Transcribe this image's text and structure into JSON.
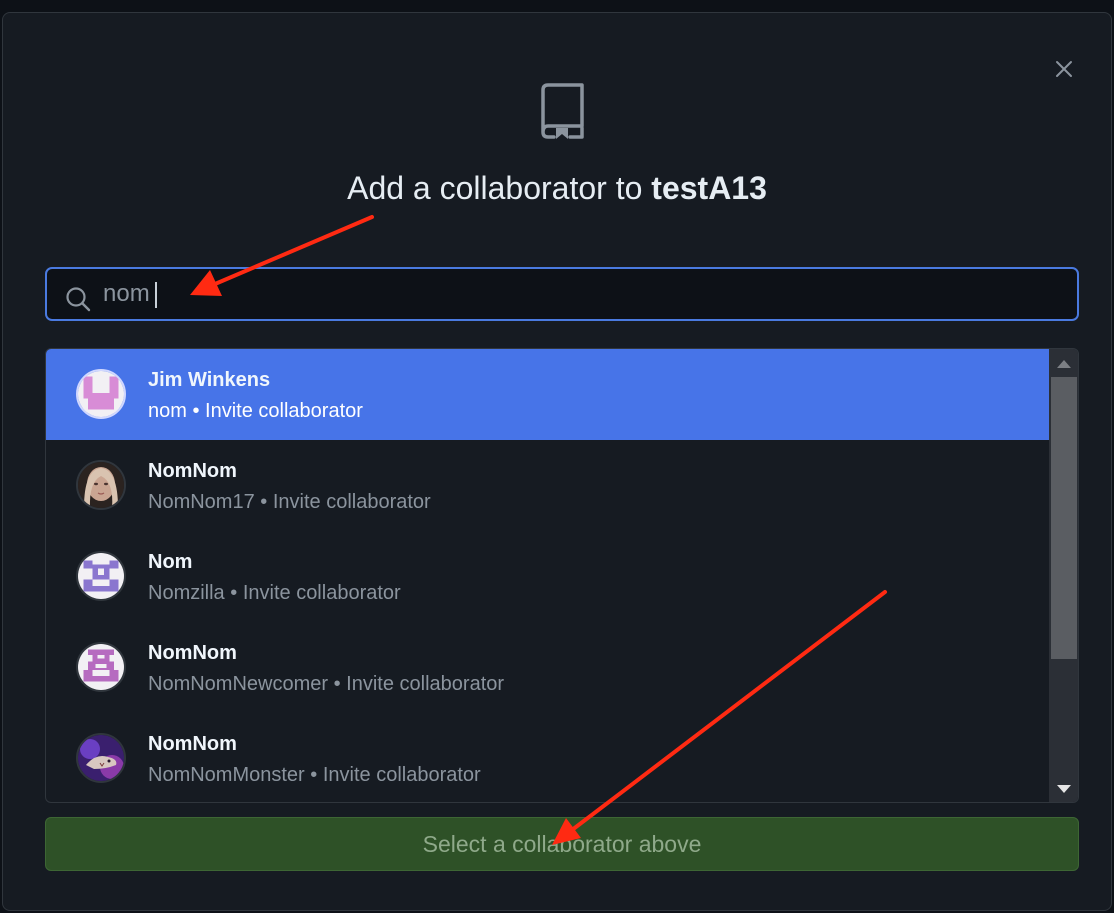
{
  "dialog": {
    "title_prefix": "Add a collaborator to",
    "repo_name": "testA13",
    "close_icon": "close-icon",
    "header_icon": "repo-icon"
  },
  "search": {
    "value": "nom",
    "icon": "search-icon"
  },
  "results": [
    {
      "display_name": "Jim Winkens",
      "username": "nom",
      "action": "Invite collaborator",
      "selected": true,
      "avatar": "identicon-pink"
    },
    {
      "display_name": "NomNom",
      "username": "NomNom17",
      "action": "Invite collaborator",
      "selected": false,
      "avatar": "photo-portrait"
    },
    {
      "display_name": "Nom",
      "username": "Nomzilla",
      "action": "Invite collaborator",
      "selected": false,
      "avatar": "identicon-purple"
    },
    {
      "display_name": "NomNom",
      "username": "NomNomNewcomer",
      "action": "Invite collaborator",
      "selected": false,
      "avatar": "identicon-magenta"
    },
    {
      "display_name": "NomNom",
      "username": "NomNomMonster",
      "action": "Invite collaborator",
      "selected": false,
      "avatar": "photo-monster"
    }
  ],
  "separator": "•",
  "submit": {
    "label": "Select a collaborator above"
  },
  "colors": {
    "selected_row": "#4774e8",
    "search_border": "#4a7ae0",
    "submit_bg": "#2e5127",
    "annotation_arrow": "#ff2a12"
  }
}
